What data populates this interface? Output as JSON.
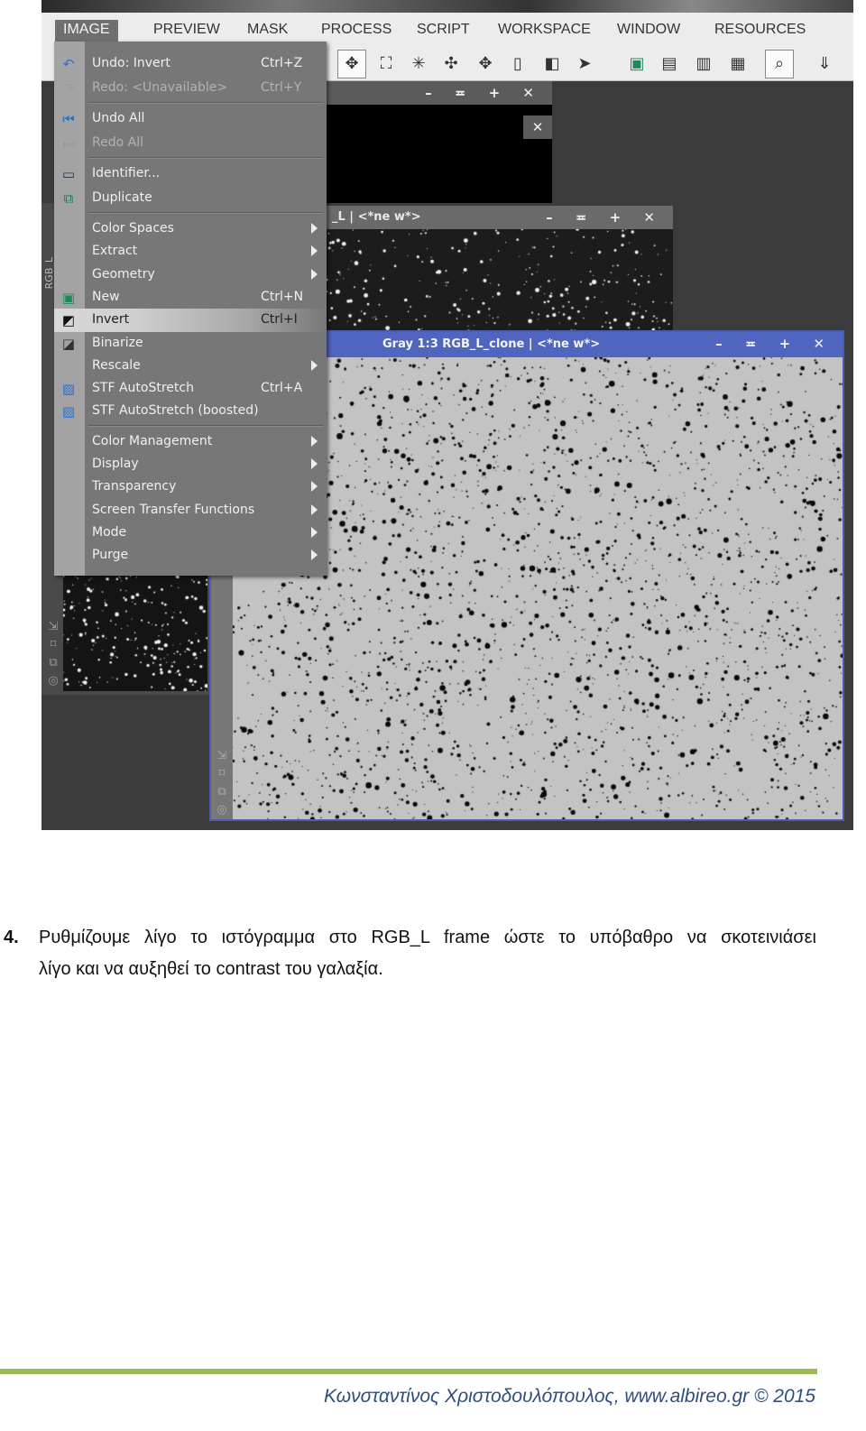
{
  "app": {
    "menubar": [
      "IMAGE",
      "PREVIEW",
      "MASK",
      "PROCESS",
      "SCRIPT",
      "WORKSPACE",
      "WINDOW",
      "RESOURCES"
    ],
    "active_menu": "IMAGE",
    "toolbar_icons": [
      "pan-icon",
      "zoom-fit-icon",
      "zoom-in-icon",
      "zoom-out-icon",
      "move-icon",
      "window-icon",
      "window-select-icon",
      "pointer-icon",
      "new-preview-icon",
      "edit-preview-icon",
      "clone-preview-icon",
      "delete-preview-icon",
      "readout-icon",
      "import-icon"
    ],
    "dropdown": {
      "groups": [
        [
          {
            "label": "Undo: Invert",
            "shortcut": "Ctrl+Z",
            "icon": "undo-icon"
          },
          {
            "label": "Redo: <Unavailable>",
            "shortcut": "Ctrl+Y",
            "icon": "redo-icon",
            "disabled": true
          }
        ],
        [
          {
            "label": "Undo All",
            "icon": "undo-all-icon"
          },
          {
            "label": "Redo All",
            "icon": "redo-all-icon",
            "disabled": true
          }
        ],
        [
          {
            "label": "Identifier...",
            "icon": "identifier-icon"
          },
          {
            "label": "Duplicate",
            "icon": "duplicate-icon"
          }
        ],
        [
          {
            "label": "Color Spaces",
            "submenu": true
          },
          {
            "label": "Extract",
            "submenu": true
          },
          {
            "label": "Geometry",
            "submenu": true
          },
          {
            "label": "New",
            "shortcut": "Ctrl+N",
            "icon": "new-image-icon"
          },
          {
            "label": "Invert",
            "shortcut": "Ctrl+I",
            "icon": "invert-icon",
            "highlighted": true
          },
          {
            "label": "Binarize",
            "icon": "binarize-icon"
          },
          {
            "label": "Rescale",
            "submenu": true
          },
          {
            "label": "STF AutoStretch",
            "shortcut": "Ctrl+A",
            "icon": "stf-autostretch-icon"
          },
          {
            "label": "STF AutoStretch (boosted)",
            "icon": "stf-autostretch-boosted-icon"
          }
        ],
        [
          {
            "label": "Color Management",
            "submenu": true
          },
          {
            "label": "Display",
            "submenu": true
          },
          {
            "label": "Transparency",
            "submenu": true
          },
          {
            "label": "Screen Transfer Functions",
            "submenu": true
          },
          {
            "label": "Mode",
            "submenu": true
          },
          {
            "label": "Purge",
            "submenu": true
          }
        ]
      ]
    },
    "windows": {
      "middle_title": "_L | <*ne w*>",
      "main_title": "Gray 1:3 RGB_L_clone | <*ne w*>",
      "side_tab": "RGB_L",
      "controls": "– ≖ + ✕"
    },
    "colors": {
      "active_title": "#5065c0",
      "menu_bg": "#777777",
      "workspace": "#3b3b3b"
    }
  },
  "doc": {
    "step_number": "4.",
    "line1": "Ρυθμίζουμε λίγο το ιστόγραμμα στο RGB_L frame ώστε το υπόβαθρο να σκοτεινιάσει",
    "line2": "λίγο και να αυξηθεί το contrast του γαλαξία."
  },
  "footer": {
    "text": "Κωνσταντίνος Χριστοδουλόπουλος, www.albireo.gr © 2015",
    "rule_color": "#9bbb59"
  }
}
